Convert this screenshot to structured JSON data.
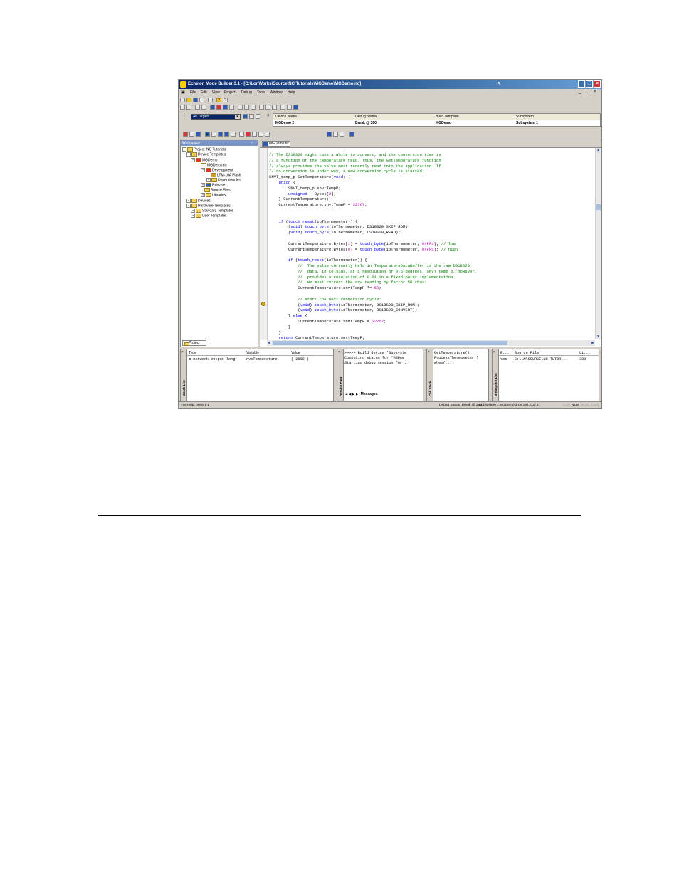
{
  "window": {
    "title": "Echelon Mode Builder 3.1 - [C:\\LonWorks\\Source\\NC Tutorials\\MGDemo\\MGDemo.nc]"
  },
  "menu": [
    "File",
    "Edit",
    "View",
    "Project",
    "Debug",
    "Tools",
    "Window",
    "Help"
  ],
  "target_select": {
    "value": "All Targets"
  },
  "device_table": {
    "headers": [
      "Device Name",
      "Debug Status",
      "Build Template",
      "Subsystem"
    ],
    "row": [
      "MGDemo 2",
      "Break @ 380",
      "MGDemo",
      "Subsystem 1"
    ]
  },
  "workspace": {
    "title": "Workspace",
    "tree": [
      "Project 'NC Tutorials'",
      "Device Templates",
      "MGDemo",
      "MGDemo.nc",
      "Development",
      "LTM-10A Flash",
      "Dependencies",
      "Release",
      "Source Files",
      "Libraries",
      "Devices",
      "Hardware Templates",
      "Standard Templates",
      "User Templates"
    ],
    "tab": "Project"
  },
  "editor": {
    "tab": "MGDemo.nc",
    "lines": [
      [
        [
          "cm",
          "// The DS18S20 might take a while to convert, and the conversion time is"
        ]
      ],
      [
        [
          "cm",
          "// a function of the temperature read. Thus, the GetTemperature function"
        ]
      ],
      [
        [
          "cm",
          "// always provides the value most recently read into the application. If"
        ]
      ],
      [
        [
          "cm",
          "// no conversion is under way, a new conversion cycle is started."
        ]
      ],
      [
        [
          "",
          "SNVT_temp_p GetTemperature("
        ],
        [
          "kw",
          "void"
        ],
        [
          "",
          ") {"
        ]
      ],
      [
        [
          "",
          "    "
        ],
        [
          "kw",
          "union"
        ],
        [
          "",
          " {"
        ]
      ],
      [
        [
          "",
          "        SNVT_temp_p snvtTempP;"
        ]
      ],
      [
        [
          "",
          "        "
        ],
        [
          "kw",
          "unsigned"
        ],
        [
          "",
          "   Bytes["
        ],
        [
          "nm",
          "2"
        ],
        [
          "",
          "];"
        ]
      ],
      [
        [
          "",
          "    } CurrentTemperature;"
        ]
      ],
      [
        [
          "",
          "    CurrentTemperature.snvtTempP = "
        ],
        [
          "nm",
          "32767"
        ],
        [
          "",
          ";"
        ]
      ],
      [
        [
          "",
          ""
        ]
      ],
      [
        [
          "",
          ""
        ]
      ],
      [
        [
          "",
          "    "
        ],
        [
          "kw",
          "if"
        ],
        [
          "",
          " ("
        ],
        [
          "kw",
          "touch_reset"
        ],
        [
          "",
          "(ioThermometer)) {"
        ]
      ],
      [
        [
          "",
          "        ("
        ],
        [
          "kw",
          "void"
        ],
        [
          "",
          ") "
        ],
        [
          "kw",
          "touch_byte"
        ],
        [
          "",
          "(ioThermometer, DS18S20_SKIP_ROM);"
        ]
      ],
      [
        [
          "",
          "        ("
        ],
        [
          "kw",
          "void"
        ],
        [
          "",
          ") "
        ],
        [
          "kw",
          "touch_byte"
        ],
        [
          "",
          "(ioThermometer, DS18S20_READ);"
        ]
      ],
      [
        [
          "",
          ""
        ]
      ],
      [
        [
          "",
          "        CurrentTemperature.Bytes["
        ],
        [
          "nm",
          "1"
        ],
        [
          "",
          "] = "
        ],
        [
          "kw",
          "touch_byte"
        ],
        [
          "",
          "(ioThermometer, "
        ],
        [
          "nm",
          "0xFFu"
        ],
        [
          "",
          "); "
        ],
        [
          "cm",
          "// low"
        ]
      ],
      [
        [
          "",
          "        CurrentTemperature.Bytes["
        ],
        [
          "nm",
          "0"
        ],
        [
          "",
          "] = "
        ],
        [
          "kw",
          "touch_byte"
        ],
        [
          "",
          "(ioThermometer, "
        ],
        [
          "nm",
          "0xFFu"
        ],
        [
          "",
          "); "
        ],
        [
          "cm",
          "// high"
        ]
      ],
      [
        [
          "",
          ""
        ]
      ],
      [
        [
          "",
          "        "
        ],
        [
          "kw",
          "if"
        ],
        [
          "",
          " ("
        ],
        [
          "kw",
          "touch_reset"
        ],
        [
          "",
          "(ioThermometer)) {"
        ]
      ],
      [
        [
          "cm",
          "            //  The value currently held in TemperatureDataBuffer is the raw DS18S20"
        ]
      ],
      [
        [
          "cm",
          "            //  data, in Celsius, at a resolution of 0.5 degrees. SNVT_temp_p, however,"
        ]
      ],
      [
        [
          "cm",
          "            //  provides a resolution of 0.01 in a fixed-point implementation."
        ]
      ],
      [
        [
          "cm",
          "            //  We must correct the raw reading by factor 50 thus:"
        ]
      ],
      [
        [
          "",
          "            CurrentTemperature.snvtTempP *= "
        ],
        [
          "nm",
          "50"
        ],
        [
          "",
          ";"
        ]
      ],
      [
        [
          "",
          ""
        ]
      ],
      [
        [
          "cm",
          "            // start the next conversion cycle:"
        ]
      ],
      [
        [
          "",
          "            ("
        ],
        [
          "kw",
          "void"
        ],
        [
          "",
          ") "
        ],
        [
          "kw",
          "touch_byte"
        ],
        [
          "",
          "(ioThermometer, DS18S20_SKIP_ROM);"
        ]
      ],
      [
        [
          "",
          "            ("
        ],
        [
          "kw",
          "void"
        ],
        [
          "",
          ") "
        ],
        [
          "kw",
          "touch_byte"
        ],
        [
          "",
          "(ioThermometer, DS18S20_CONVERT);"
        ]
      ],
      [
        [
          "",
          "        } "
        ],
        [
          "kw",
          "else"
        ],
        [
          "",
          " {"
        ]
      ],
      [
        [
          "",
          "            CurrentTemperature.snvtTempP = "
        ],
        [
          "nm",
          "32767"
        ],
        [
          "",
          ";"
        ]
      ],
      [
        [
          "",
          "        }"
        ]
      ],
      [
        [
          "",
          "    }"
        ]
      ],
      [
        [
          "",
          "    "
        ],
        [
          "kw",
          "return"
        ],
        [
          "",
          " CurrentTemperature.snvtTempP;"
        ]
      ],
      [
        [
          "",
          "}"
        ]
      ]
    ]
  },
  "watch_pane": {
    "label": "Watch List",
    "headers": [
      "Type",
      "Variable",
      "Value"
    ],
    "row": [
      "network output long",
      "nvoTemperature",
      "{ 2600 }"
    ]
  },
  "results_pane": {
    "label": "Results Pane",
    "lines": [
      ">>>>> Build device 'Subsyste",
      "Computing status for 'MGDem",
      "Starting debug session for :"
    ],
    "tab": "Messages"
  },
  "call_stack_pane": {
    "label": "Call Stack",
    "lines": [
      "GetTemperature()",
      "ProcessThermometer()",
      "when(...)"
    ]
  },
  "breakpoint_pane": {
    "label": "Breakpoint List",
    "headers": [
      "E...",
      "Source File",
      "Li..."
    ],
    "row": [
      "Yes",
      "C:\\LM\\SOURCE\\NC TUTOR...",
      "380"
    ]
  },
  "statusbar": {
    "help": "For Help, press F1",
    "debug_status": "Debug Status: Break @ 380",
    "location": "Subsystem 1.MGDemo 2   Ln 194, Col 3",
    "indicators": [
      "CAP",
      "NUM",
      "SCRL",
      "OVR"
    ]
  },
  "colors": {
    "titlebar": "#0a246a",
    "comment": "#008000",
    "keyword": "#0000ff",
    "number": "#c000c0"
  }
}
